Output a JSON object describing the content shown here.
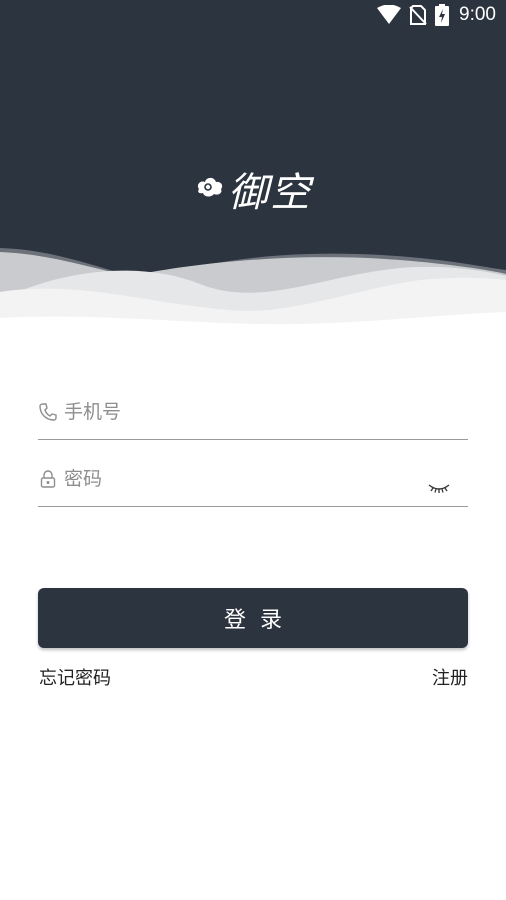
{
  "status_bar": {
    "time": "9:00",
    "icons": [
      "wifi-icon",
      "no-sim-icon",
      "battery-charging-icon"
    ]
  },
  "brand": {
    "logo_text": "御空",
    "logo_icon": "cloud-swirl-icon"
  },
  "form": {
    "phone_placeholder": "手机号",
    "phone_value": "",
    "password_placeholder": "密码",
    "password_value": "",
    "phone_icon": "phone-icon",
    "password_icon": "lock-icon",
    "toggle_icon": "eye-closed-icon"
  },
  "actions": {
    "login_label": "登录",
    "forgot_label": "忘记密码",
    "register_label": "注册"
  },
  "colors": {
    "header_bg": "#2c3440",
    "button_bg": "#2c3440",
    "divider": "#9a9a9a",
    "placeholder": "#8e8e8e"
  }
}
